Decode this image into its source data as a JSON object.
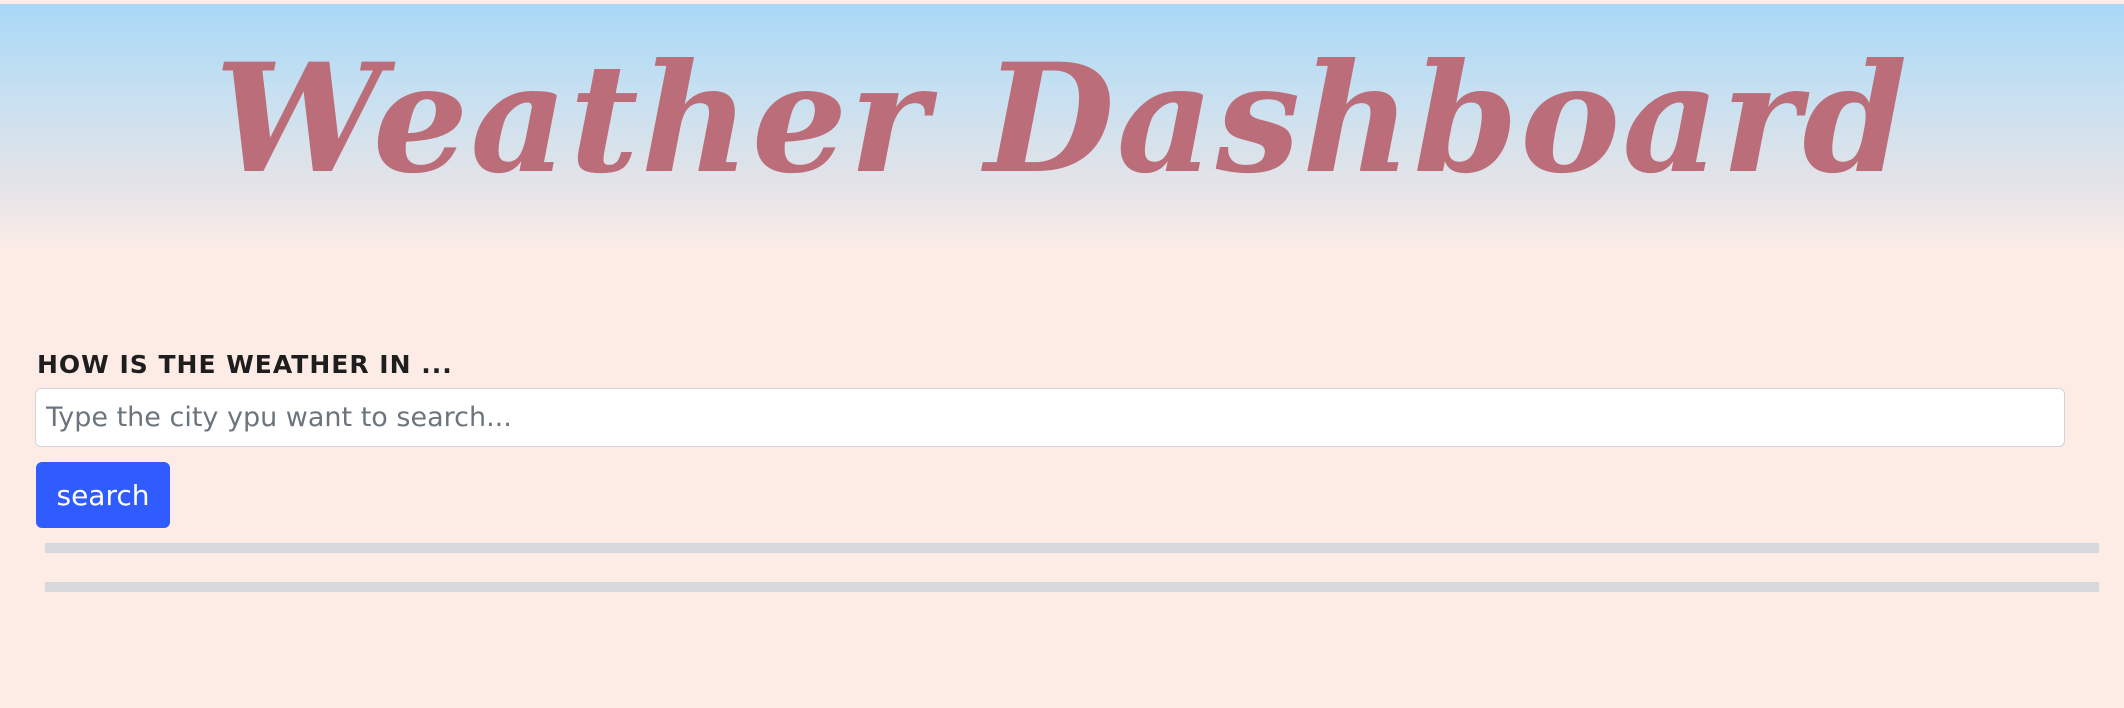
{
  "header": {
    "title": "Weather Dashboard"
  },
  "search": {
    "label": "How is the weather in ...",
    "placeholder": "Type the city ypu want to search...",
    "value": "",
    "button_label": "search"
  },
  "colors": {
    "title": "#bb6e7a",
    "background": "#fdece6",
    "header_top": "#a8d8f6",
    "button": "#2f5bff",
    "divider": "#d6d9dc"
  }
}
